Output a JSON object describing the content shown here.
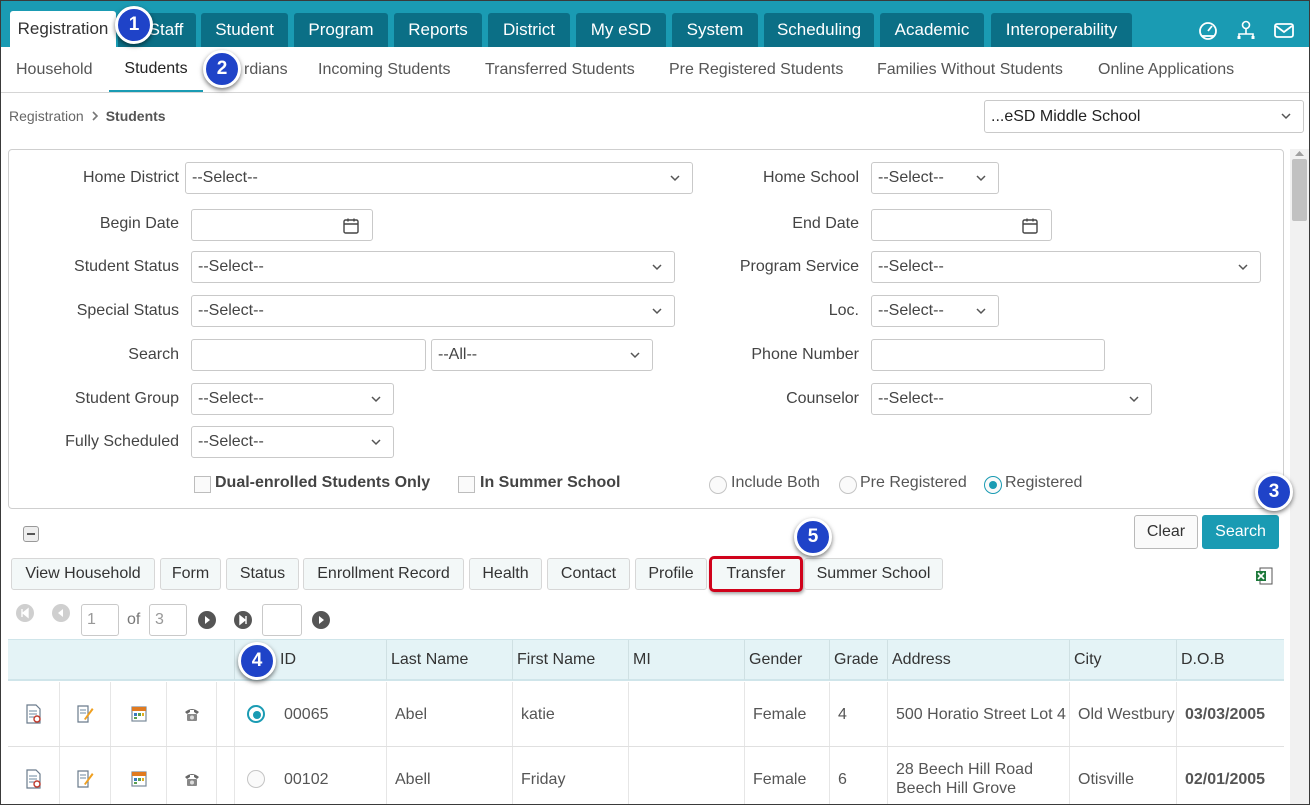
{
  "topnav": {
    "tabs": [
      "Registration",
      "Staff",
      "Student",
      "Program",
      "Reports",
      "District",
      "My eSD",
      "System",
      "Scheduling",
      "Academic",
      "Interoperability"
    ],
    "icons": [
      "dashboard-icon",
      "user-tree-icon",
      "mail-icon"
    ]
  },
  "subnav": {
    "items": [
      "Household",
      "Students",
      "Guardians",
      "Incoming Students",
      "Transferred Students",
      "Pre Registered Students",
      "Families Without Students",
      "Online Applications"
    ],
    "guardians_visible": "rdians"
  },
  "breadcrumb": {
    "parent": "Registration",
    "current": "Students"
  },
  "school_select": "...eSD Middle School",
  "filters": {
    "home_district": {
      "label": "Home District",
      "value": "--Select--"
    },
    "home_school": {
      "label": "Home School",
      "value": "--Select--"
    },
    "begin_date": {
      "label": "Begin Date"
    },
    "end_date": {
      "label": "End Date"
    },
    "student_status": {
      "label": "Student Status",
      "value": "--Select--"
    },
    "program_service": {
      "label": "Program Service",
      "value": "--Select--"
    },
    "special_status": {
      "label": "Special Status",
      "value": "--Select--"
    },
    "loc": {
      "label": "Loc.",
      "value": "--Select--"
    },
    "search": {
      "label": "Search",
      "scope": "--All--"
    },
    "phone_number": {
      "label": "Phone Number"
    },
    "student_group": {
      "label": "Student Group",
      "value": "--Select--"
    },
    "counselor": {
      "label": "Counselor",
      "value": "--Select--"
    },
    "fully_scheduled": {
      "label": "Fully Scheduled",
      "value": "--Select--"
    },
    "dual_enrolled": "Dual-enrolled Students Only",
    "summer_school": "In Summer School",
    "radios": [
      "Include Both",
      "Pre Registered",
      "Registered"
    ],
    "radio_selected": "Registered"
  },
  "actions": {
    "clear": "Clear",
    "search": "Search"
  },
  "toolbar": [
    "View Household",
    "Form",
    "Status",
    "Enrollment Record",
    "Health",
    "Contact",
    "Profile",
    "Transfer",
    "Summer School"
  ],
  "pager": {
    "page": "1",
    "of": "of",
    "total": "3"
  },
  "table": {
    "columns": [
      "ID",
      "Last Name",
      "First Name",
      "MI",
      "Gender",
      "Grade",
      "Address",
      "City",
      "D.O.B"
    ],
    "rows": [
      {
        "id": "00065",
        "last": "Abel",
        "first": "katie",
        "mi": "",
        "gender": "Female",
        "grade": "4",
        "address": "500 Horatio Street Lot 4",
        "city": "Old Westbury",
        "dob": "03/03/2005",
        "selected": true
      },
      {
        "id": "00102",
        "last": "Abell",
        "first": "Friday",
        "mi": "",
        "gender": "Female",
        "grade": "6",
        "address": "28 Beech Hill Road Beech Hill Grove",
        "city": "Otisville",
        "dob": "02/01/2005",
        "selected": false
      }
    ]
  },
  "callouts": [
    "1",
    "2",
    "3",
    "4",
    "5"
  ],
  "colors": {
    "nav": "#1a9bb3",
    "tab": "#0b6f86",
    "badge": "#1f43c8",
    "highlight": "#d0021b"
  }
}
